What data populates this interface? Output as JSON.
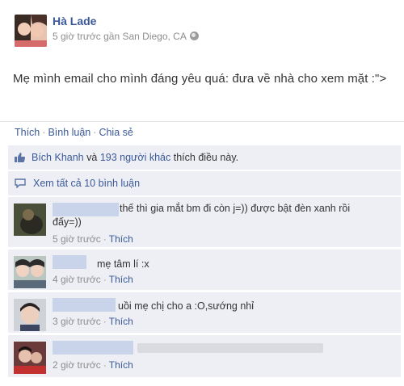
{
  "post": {
    "author": "Hà Lade",
    "meta": "5 giờ trước gần San Diego, CA",
    "text": "Mẹ mình email cho mình đáng yêu quá: đưa về nhà cho xem mặt :\">"
  },
  "actions": {
    "like": "Thích",
    "comment": "Bình luận",
    "share": "Chia sẻ"
  },
  "likes": {
    "name": "Bích Khanh",
    "and": "và",
    "others": "193 người khác",
    "suffix": "thích điều này."
  },
  "view_all": "Xem tất cả 10 bình luận",
  "comments": [
    {
      "text1": "thế thì gia mắt bm đi còn j=)) được bật đèn xanh rồi",
      "text2": "đấy=))",
      "time": "5 giờ trước",
      "like": "Thích"
    },
    {
      "text1": "mẹ tâm lí :x",
      "time": "4 giờ trước",
      "like": "Thích"
    },
    {
      "text1": "uồi mẹ chị cho a :O,sướng nhỉ",
      "time": "3 giờ trước",
      "like": "Thích"
    },
    {
      "text1": "",
      "time": "2 giờ trước",
      "like": "Thích"
    }
  ],
  "colors": {
    "link": "#3b5998",
    "panel": "#edeff4",
    "meta": "#8d8d8d"
  }
}
